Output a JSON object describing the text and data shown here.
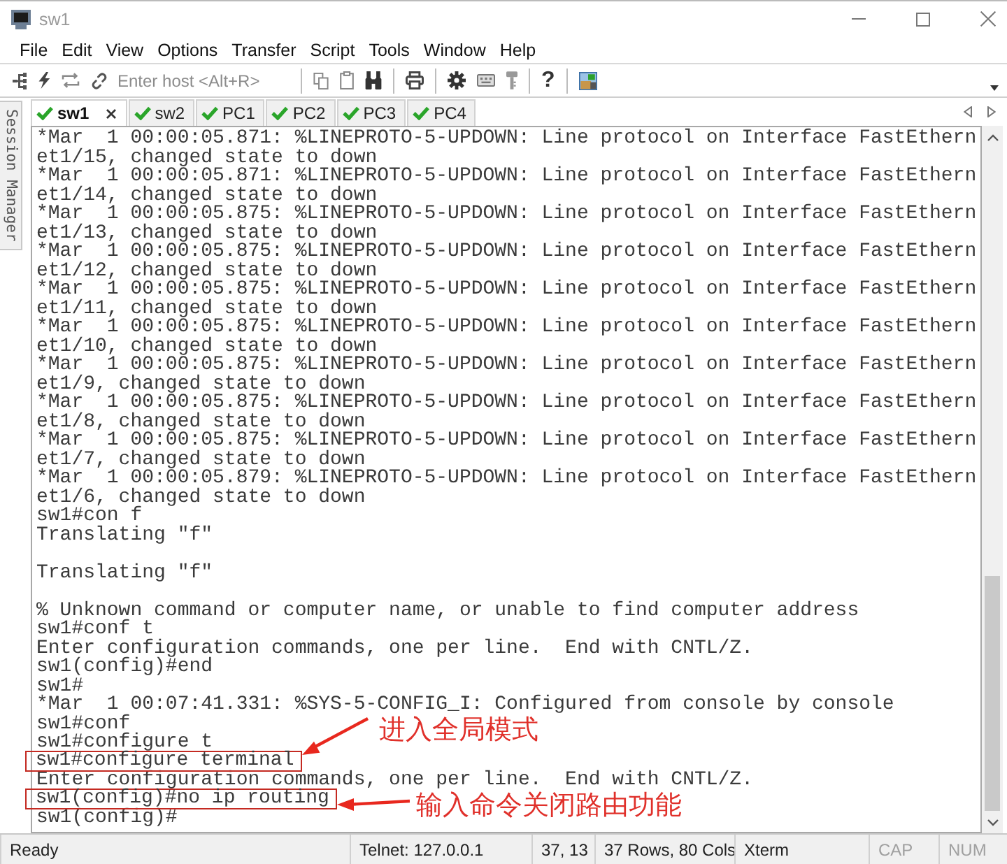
{
  "window": {
    "title": "sw1"
  },
  "menu": [
    "File",
    "Edit",
    "View",
    "Options",
    "Transfer",
    "Script",
    "Tools",
    "Window",
    "Help"
  ],
  "toolbar": {
    "host_field": {
      "placeholder": "Enter host <Alt+R>"
    },
    "help_button": "?"
  },
  "session_manager": {
    "label": "Session Manager"
  },
  "tabs": [
    {
      "label": "sw1",
      "selected": true,
      "connected": true
    },
    {
      "label": "sw2",
      "selected": false,
      "connected": true
    },
    {
      "label": "PC1",
      "selected": false,
      "connected": true
    },
    {
      "label": "PC2",
      "selected": false,
      "connected": true
    },
    {
      "label": "PC3",
      "selected": false,
      "connected": true
    },
    {
      "label": "PC4",
      "selected": false,
      "connected": true
    }
  ],
  "terminal": {
    "lines": [
      {
        "kind": "text",
        "text": "*Mar  1 00:00:05.871: %LINEPROTO-5-UPDOWN: Line protocol on Interface FastEthern"
      },
      {
        "kind": "text",
        "text": "et1/15, changed state to down"
      },
      {
        "kind": "text",
        "text": "*Mar  1 00:00:05.871: %LINEPROTO-5-UPDOWN: Line protocol on Interface FastEthern"
      },
      {
        "kind": "text",
        "text": "et1/14, changed state to down"
      },
      {
        "kind": "text",
        "text": "*Mar  1 00:00:05.875: %LINEPROTO-5-UPDOWN: Line protocol on Interface FastEthern"
      },
      {
        "kind": "text",
        "text": "et1/13, changed state to down"
      },
      {
        "kind": "text",
        "text": "*Mar  1 00:00:05.875: %LINEPROTO-5-UPDOWN: Line protocol on Interface FastEthern"
      },
      {
        "kind": "text",
        "text": "et1/12, changed state to down"
      },
      {
        "kind": "text",
        "text": "*Mar  1 00:00:05.875: %LINEPROTO-5-UPDOWN: Line protocol on Interface FastEthern"
      },
      {
        "kind": "text",
        "text": "et1/11, changed state to down"
      },
      {
        "kind": "text",
        "text": "*Mar  1 00:00:05.875: %LINEPROTO-5-UPDOWN: Line protocol on Interface FastEthern"
      },
      {
        "kind": "text",
        "text": "et1/10, changed state to down"
      },
      {
        "kind": "text",
        "text": "*Mar  1 00:00:05.875: %LINEPROTO-5-UPDOWN: Line protocol on Interface FastEthern"
      },
      {
        "kind": "text",
        "text": "et1/9, changed state to down"
      },
      {
        "kind": "text",
        "text": "*Mar  1 00:00:05.875: %LINEPROTO-5-UPDOWN: Line protocol on Interface FastEthern"
      },
      {
        "kind": "text",
        "text": "et1/8, changed state to down"
      },
      {
        "kind": "text",
        "text": "*Mar  1 00:00:05.875: %LINEPROTO-5-UPDOWN: Line protocol on Interface FastEthern"
      },
      {
        "kind": "text",
        "text": "et1/7, changed state to down"
      },
      {
        "kind": "text",
        "text": "*Mar  1 00:00:05.879: %LINEPROTO-5-UPDOWN: Line protocol on Interface FastEthern"
      },
      {
        "kind": "text",
        "text": "et1/6, changed state to down"
      },
      {
        "kind": "text",
        "text": "sw1#con f"
      },
      {
        "kind": "text",
        "text": "Translating \"f\""
      },
      {
        "kind": "blank"
      },
      {
        "kind": "text",
        "text": "Translating \"f\""
      },
      {
        "kind": "blank"
      },
      {
        "kind": "text",
        "text": "% Unknown command or computer name, or unable to find computer address"
      },
      {
        "kind": "text",
        "text": "sw1#conf t"
      },
      {
        "kind": "text",
        "text": "Enter configuration commands, one per line.  End with CNTL/Z."
      },
      {
        "kind": "text",
        "text": "sw1(config)#end"
      },
      {
        "kind": "text",
        "text": "sw1#"
      },
      {
        "kind": "text",
        "text": "*Mar  1 00:07:41.331: %SYS-5-CONFIG_I: Configured from console by console"
      },
      {
        "kind": "text",
        "text": "sw1#conf"
      },
      {
        "kind": "text",
        "text": "sw1#configure t"
      },
      {
        "kind": "text",
        "text": "sw1#configure terminal",
        "callout": {
          "kind": "above",
          "text": "进入全局模式"
        }
      },
      {
        "kind": "text",
        "text": "Enter configuration commands, one per line.  End with CNTL/Z."
      },
      {
        "kind": "text",
        "text": "sw1(config)#no ip routing",
        "callout": {
          "kind": "beside",
          "text": "输入命令关闭路由功能"
        }
      },
      {
        "kind": "text",
        "text": "sw1(config)#"
      }
    ]
  },
  "status_bar": {
    "message": "Ready",
    "connection": "Telnet: 127.0.0.1",
    "cursor": "37, 13",
    "size": "37 Rows, 80 Cols",
    "emulation": "Xterm",
    "indicators": [
      {
        "label": "CAP",
        "on": false
      },
      {
        "label": "NUM",
        "on": false
      }
    ]
  }
}
